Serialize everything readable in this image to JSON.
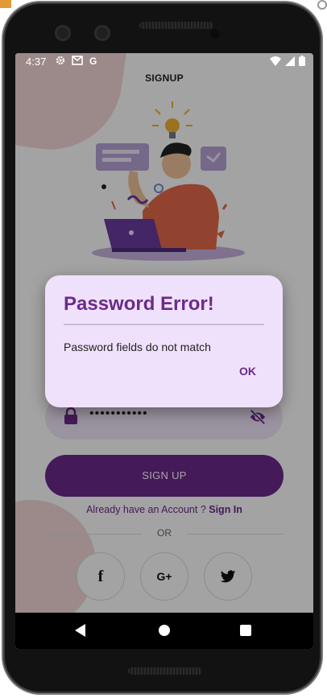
{
  "statusbar": {
    "time": "4:37",
    "left_icons": [
      "gear-icon",
      "gmail-icon",
      "google-g-icon"
    ],
    "right_icons": [
      "wifi-icon",
      "signal-icon",
      "battery-icon"
    ]
  },
  "page": {
    "title": "SIGNUP"
  },
  "password_field": {
    "value": "•••••••••••"
  },
  "signup_button": {
    "label": "SIGN UP"
  },
  "account_prompt": {
    "text": "Already have an Account ? ",
    "link": "Sign In"
  },
  "divider": {
    "label": "OR"
  },
  "social": [
    {
      "name": "facebook",
      "glyph": "f"
    },
    {
      "name": "google-plus",
      "glyph": "G+"
    },
    {
      "name": "twitter",
      "glyph": ""
    }
  ],
  "dialog": {
    "title": "Password Error!",
    "message": "Password fields do not match",
    "ok_label": "OK"
  },
  "colors": {
    "accent": "#6c2a8c",
    "dialog_bg": "#efe1fb",
    "field_bg": "#f1e6fb",
    "blob": "#f4d7d7"
  }
}
